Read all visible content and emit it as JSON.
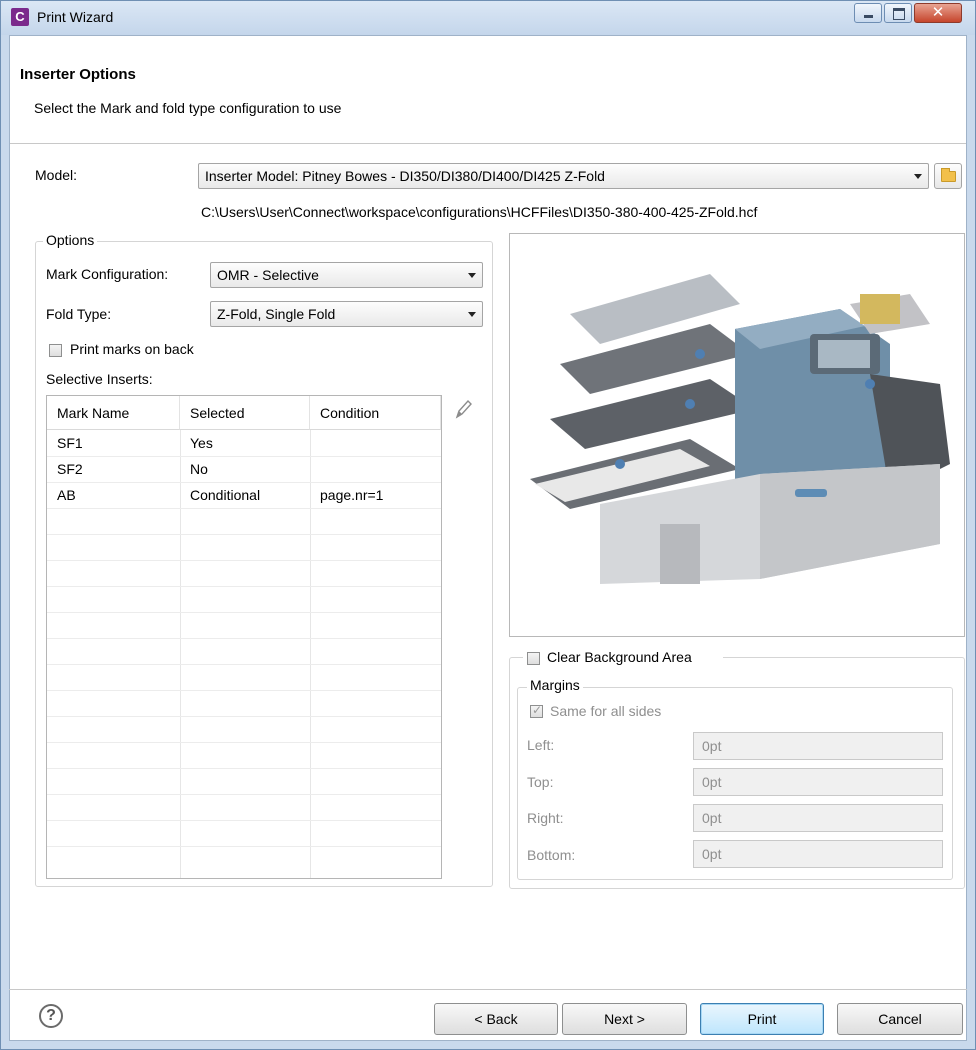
{
  "window": {
    "title": "Print Wizard",
    "app_icon": "C"
  },
  "header": {
    "title": "Inserter Options",
    "description": "Select the Mark and fold type configuration to use"
  },
  "model": {
    "label": "Model:",
    "value": "Inserter Model: Pitney Bowes - DI350/DI380/DI400/DI425 Z-Fold",
    "path": "C:\\Users\\User\\Connect\\workspace\\configurations\\HCFFiles\\DI350-380-400-425-ZFold.hcf"
  },
  "options": {
    "group_title": "Options",
    "mark_config_label": "Mark Configuration:",
    "mark_config_value": "OMR - Selective",
    "fold_type_label": "Fold Type:",
    "fold_type_value": "Z-Fold, Single Fold",
    "print_marks_label": "Print marks on back",
    "selective_inserts_label": "Selective Inserts:"
  },
  "table": {
    "columns": [
      "Mark Name",
      "Selected",
      "Condition"
    ],
    "rows": [
      [
        "SF1",
        "Yes",
        ""
      ],
      [
        "SF2",
        "No",
        ""
      ],
      [
        "AB",
        "Conditional",
        "page.nr=1"
      ]
    ]
  },
  "background": {
    "clear_label": "Clear Background Area",
    "margins_title": "Margins",
    "same_for_all_label": "Same for all sides",
    "left_label": "Left:",
    "left_value": "0pt",
    "top_label": "Top:",
    "top_value": "0pt",
    "right_label": "Right:",
    "right_value": "0pt",
    "bottom_label": "Bottom:",
    "bottom_value": "0pt"
  },
  "buttons": {
    "back": "< Back",
    "next": "Next >",
    "print": "Print",
    "cancel": "Cancel",
    "help": "?"
  },
  "icons": {
    "app": "app-c-icon",
    "folder": "folder-icon",
    "edit": "pencil-icon",
    "help": "help-icon"
  }
}
